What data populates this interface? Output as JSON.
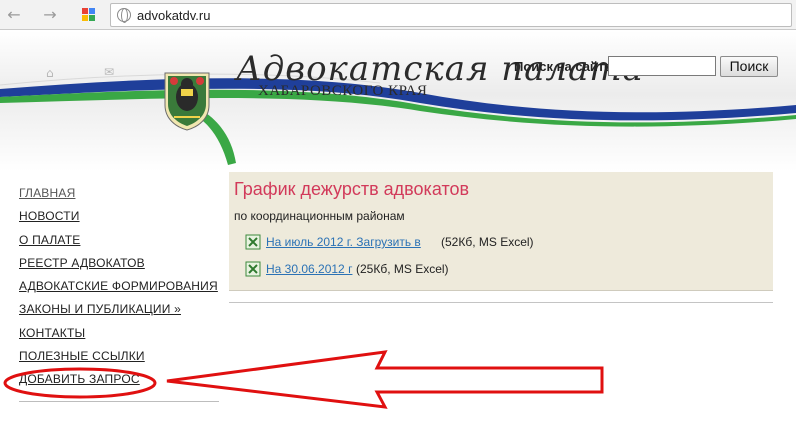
{
  "browser": {
    "url": "advokatdv.ru",
    "back_icon": "back-arrow-icon",
    "forward_icon": "forward-arrow-icon"
  },
  "header": {
    "logo_script": "Адвокатская палата",
    "logo_subtitle": "ХАБАРОВСКОГО КРАЯ",
    "search_label": "Поиск на сайте:",
    "search_value": "",
    "search_button": "Поиск",
    "colors": {
      "ribbon_blue": "#1f3f9a",
      "ribbon_green": "#3aa845"
    }
  },
  "sidebar": {
    "items": [
      {
        "label": "ГЛАВНАЯ"
      },
      {
        "label": "НОВОСТИ"
      },
      {
        "label": "О ПАЛАТЕ"
      },
      {
        "label": "РЕЕСТР АДВОКАТОВ"
      },
      {
        "label": "АДВОКАТСКИЕ ФОРМИРОВАНИЯ"
      },
      {
        "label": "ЗАКОНЫ И ПУБЛИКАЦИИ »"
      },
      {
        "label": "КОНТАКТЫ"
      },
      {
        "label": "ПОЛЕЗНЫЕ ССЫЛКИ"
      },
      {
        "label": "ДОБАВИТЬ ЗАПРОС"
      }
    ]
  },
  "main": {
    "title": "График дежурств адвокатов",
    "subtitle": "по координационным районам",
    "files": [
      {
        "link": "На июль 2012 г. Загрузить в",
        "meta": "(52Кб, MS Excel)"
      },
      {
        "link": "На 30.06.2012 г",
        "meta": "(25Кб, MS Excel)"
      }
    ],
    "colors": {
      "title": "#d23a5a",
      "box_bg": "#eeeadb",
      "link": "#2b72b5"
    }
  },
  "annotation": {
    "color": "#e01010"
  }
}
